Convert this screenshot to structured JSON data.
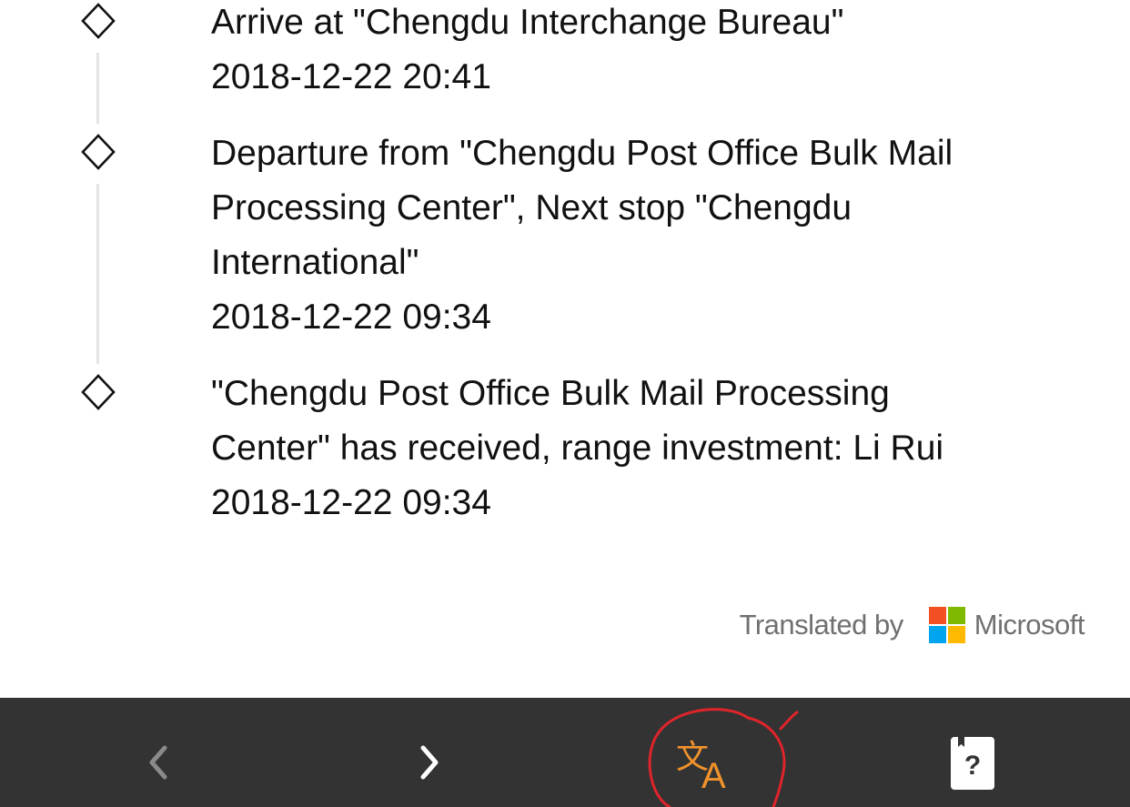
{
  "events": [
    {
      "description": "Arrive at \"Chengdu Interchange Bureau\"",
      "time": "2018-12-22 20:41"
    },
    {
      "description": "Departure from \"Chengdu Post Office Bulk Mail\nProcessing Center\", Next stop \"Chengdu\nInternational\"",
      "time": "2018-12-22 09:34"
    },
    {
      "description": "\"Chengdu Post Office Bulk Mail Processing\nCenter\" has received, range investment: Li Rui",
      "time": "2018-12-22 09:34"
    }
  ],
  "attribution": {
    "label": "Translated by",
    "brand": "Microsoft",
    "logo_colors": [
      "#f25022",
      "#7fba00",
      "#00a4ef",
      "#ffb900"
    ]
  },
  "toolbar": {
    "background": "#333333",
    "back_icon": "chevron-left-icon",
    "forward_icon": "chevron-right-icon",
    "translate_icon": "translate-icon",
    "translate_glyph_cjk": "文",
    "translate_glyph_latin": "A",
    "translate_color": "#f0922b",
    "help_icon": "help-card-icon",
    "help_glyph": "?",
    "annotation_color": "#e0242b"
  }
}
